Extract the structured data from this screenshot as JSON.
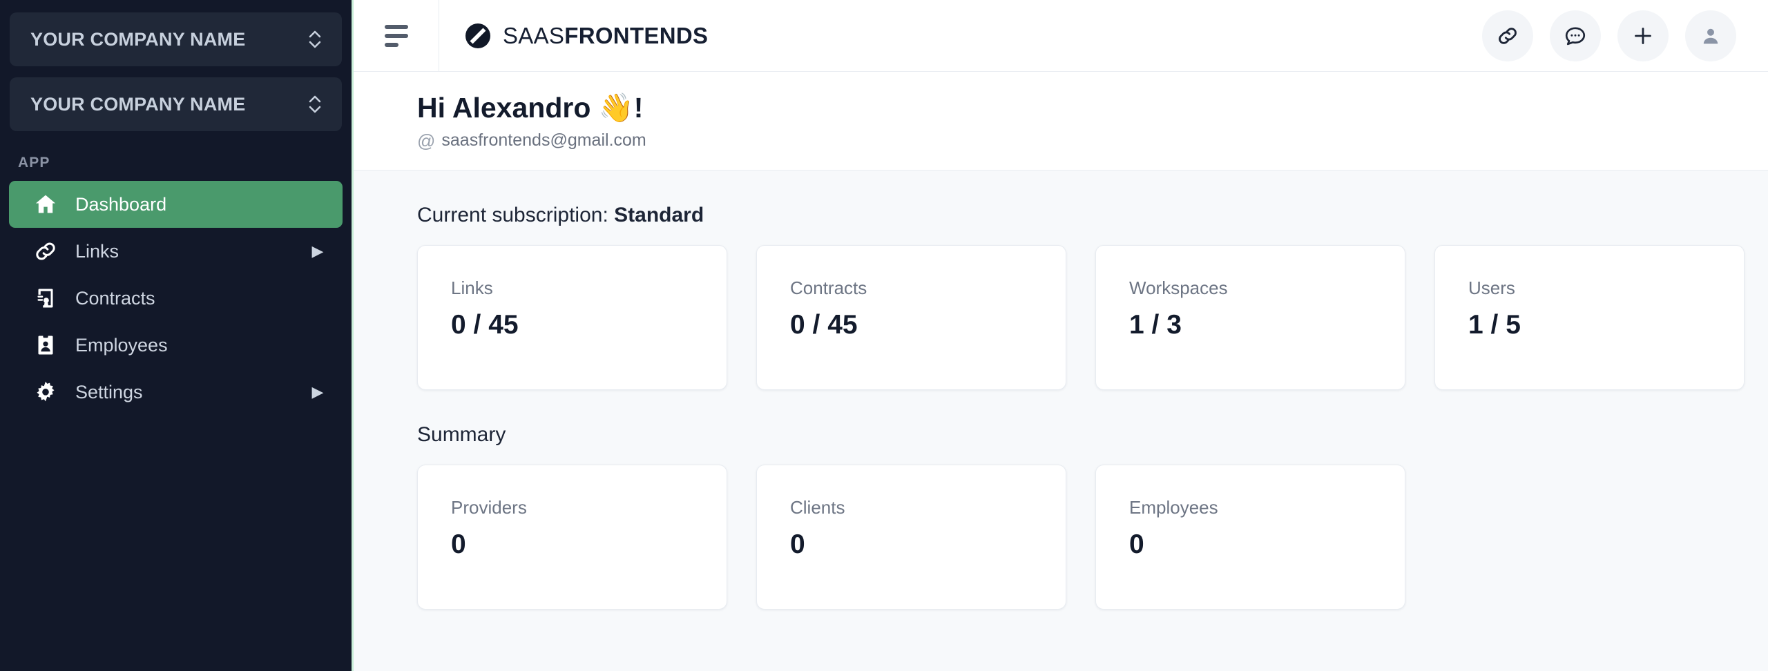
{
  "sidebar": {
    "org_switchers": [
      {
        "label": "YOUR COMPANY NAME",
        "icon": "chevron-up-down-icon"
      },
      {
        "label": "YOUR COMPANY NAME",
        "icon": "chevron-up-down-icon"
      }
    ],
    "section_label": "APP",
    "items": [
      {
        "label": "Dashboard",
        "icon": "home-icon",
        "active": true,
        "caret": ""
      },
      {
        "label": "Links",
        "icon": "link-icon",
        "active": false,
        "caret": "▶"
      },
      {
        "label": "Contracts",
        "icon": "contract-icon",
        "active": false,
        "caret": ""
      },
      {
        "label": "Employees",
        "icon": "badge-icon",
        "active": false,
        "caret": ""
      },
      {
        "label": "Settings",
        "icon": "gear-icon",
        "active": false,
        "caret": "▶"
      }
    ],
    "colors": {
      "background": "#121829",
      "active": "#4a9a6c",
      "switcher": "#202838",
      "border": "#c9eed8"
    }
  },
  "topbar": {
    "menu_icon": "hamburger-icon",
    "brand": {
      "icon": "saasfrontends-logo",
      "text_light": "SAAS",
      "text_bold": "FRONTENDS"
    },
    "actions": [
      {
        "name": "link-button",
        "icon": "link-icon"
      },
      {
        "name": "chat-button",
        "icon": "chat-bubble-icon"
      },
      {
        "name": "add-button",
        "icon": "plus-icon"
      },
      {
        "name": "profile-button",
        "icon": "user-avatar-icon"
      }
    ]
  },
  "greeting": {
    "title": "Hi Alexandro 👋!",
    "at_symbol": "@",
    "email": "saasfrontends@gmail.com"
  },
  "content": {
    "subscription_prefix": "Current subscription:",
    "subscription_plan": "Standard",
    "quota_cards": [
      {
        "label": "Links",
        "value": "0 / 45"
      },
      {
        "label": "Contracts",
        "value": "0 / 45"
      },
      {
        "label": "Workspaces",
        "value": "1 / 3"
      },
      {
        "label": "Users",
        "value": "1 / 5"
      }
    ],
    "summary_title": "Summary",
    "summary_cards": [
      {
        "label": "Providers",
        "value": "0"
      },
      {
        "label": "Clients",
        "value": "0"
      },
      {
        "label": "Employees",
        "value": "0"
      }
    ]
  }
}
